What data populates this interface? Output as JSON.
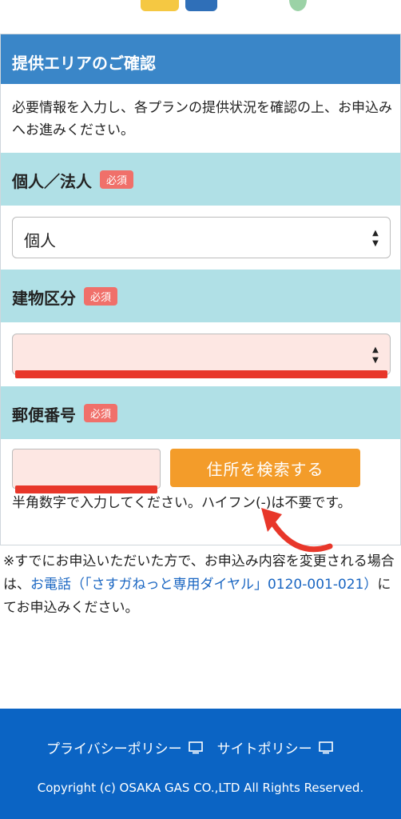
{
  "card": {
    "title": "提供エリアのご確認",
    "intro": "必要情報を入力し、各プランの提供状況を確認の上、お申込みへお進みください。"
  },
  "required_badge": "必須",
  "sections": {
    "entity": {
      "label": "個人／法人",
      "selected": "個人"
    },
    "building": {
      "label": "建物区分",
      "selected": ""
    },
    "zip": {
      "label": "郵便番号",
      "value": "",
      "search_button": "住所を検索する",
      "note": "半角数字で入力してください。ハイフン(-)は不要です。"
    }
  },
  "notice": {
    "before": "※すでにお申込いただいた方で、お申込み内容を変更される場合は、",
    "link": "お電話（「さすガねっと専用ダイヤル」0120-001-021）",
    "after": "にてお申込みください。"
  },
  "footer": {
    "privacy": "プライバシーポリシー",
    "site_policy": "サイトポリシー",
    "copyright": "Copyright (c) OSAKA GAS CO.,LTD All Rights Reserved."
  },
  "colors": {
    "header": "#3a86c8",
    "section": "#b0e0e6",
    "badge": "#f0706a",
    "error_field": "#fde7e3",
    "button": "#f39c2a",
    "annotation": "#e8372a",
    "footer": "#0b64c4"
  }
}
